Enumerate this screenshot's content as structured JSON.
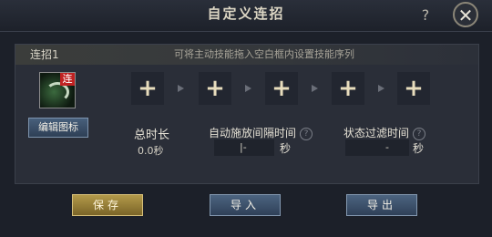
{
  "window": {
    "title": "自定义连招",
    "help_label": "?",
    "close_label": "✕"
  },
  "combo": {
    "name": "连招1",
    "hint": "可将主动技能拖入空白框内设置技能序列",
    "skill_badge": "连",
    "edit_icon_label": "编辑图标",
    "slots": [
      "+",
      "+",
      "+",
      "+",
      "+"
    ]
  },
  "fields": {
    "total_time_label": "总时长",
    "total_time_value": "0.0秒",
    "auto_interval_label": "自动施放间隔时间",
    "auto_interval_value": "|-",
    "auto_interval_unit": "秒",
    "filter_time_label": "状态过滤时间",
    "filter_time_value": "-",
    "filter_time_unit": "秒",
    "help_glyph": "?"
  },
  "buttons": {
    "save": "保存",
    "import": "导入",
    "export": "导出"
  }
}
